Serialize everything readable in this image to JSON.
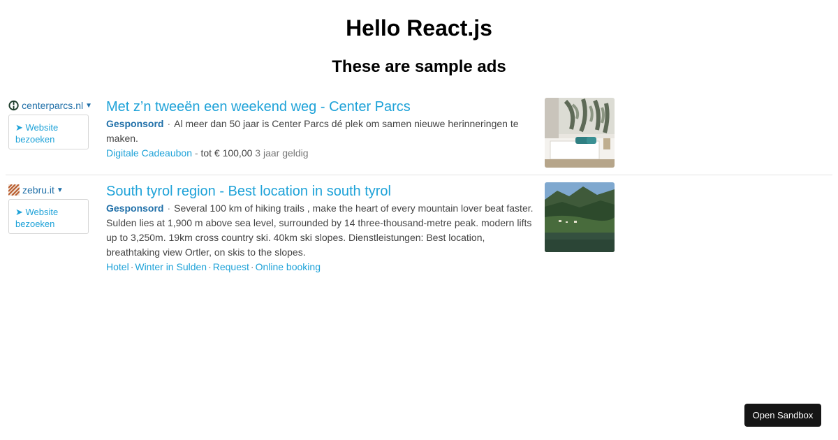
{
  "page": {
    "title": "Hello React.js",
    "subtitle": "These are sample ads"
  },
  "ads": [
    {
      "domain": "centerparcs.nl",
      "visit_label": "➤ Website bezoeken",
      "title": "Met z’n tweeën een weekend weg - Center Parcs",
      "sponsored": "Gesponsord",
      "description": "Al meer dan 50 jaar is Center Parcs dé plek om samen nieuwe herinneringen te maken.",
      "extension": {
        "link": "Digitale Cadeaubon",
        "separator": "-",
        "price": "tot € 100,00",
        "note": "3 jaar geldig"
      },
      "logo_icon": "centerparcs-logo-icon",
      "image_icon": "hotel-room-image"
    },
    {
      "domain": "zebru.it",
      "visit_label": "➤ Website bezoeken",
      "title": "South tyrol region - Best location in south tyrol",
      "sponsored": "Gesponsord",
      "description": "Several 100 km of hiking trails , make the heart of every mountain lover beat faster. Sulden lies at 1,900 m above sea level, surrounded by 14 three-thousand-metre peak. modern lifts up to 3,250m. 19km cross country ski. 40km ski slopes. Dienstleistungen: Best location, breathtaking view Ortler, on skis to the slopes.",
      "sitelinks": [
        "Hotel",
        "Winter in Sulden",
        "Request",
        "Online booking"
      ],
      "logo_icon": "zebru-logo-icon",
      "image_icon": "mountain-lake-image"
    }
  ],
  "sandbox_button": "Open Sandbox"
}
